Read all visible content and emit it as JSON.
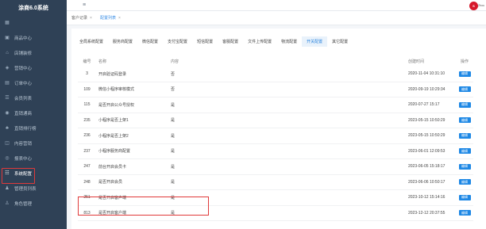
{
  "app": {
    "title": "涂商6.0系统",
    "user_avatar_text": "S",
    "user_name": "Zhou"
  },
  "sidebar": {
    "items": [
      {
        "label": "",
        "icon": "grid-icon"
      },
      {
        "label": "商品中心",
        "icon": "box-icon"
      },
      {
        "label": "店铺装修",
        "icon": "store-icon"
      },
      {
        "label": "营销中心",
        "icon": "promo-icon"
      },
      {
        "label": "订单中心",
        "icon": "order-icon"
      },
      {
        "label": "会员列表",
        "icon": "member-icon"
      },
      {
        "label": "直销通商",
        "icon": "channel-icon"
      },
      {
        "label": "直销排行榜",
        "icon": "ranking-icon"
      },
      {
        "label": "内容营销",
        "icon": "content-icon"
      },
      {
        "label": "报表中心",
        "icon": "report-icon"
      },
      {
        "label": "系统配置",
        "icon": "settings-icon",
        "active": true
      },
      {
        "label": "管理员列表",
        "icon": "admin-icon"
      },
      {
        "label": "角色管理",
        "icon": "role-icon"
      }
    ]
  },
  "page_tabs": [
    {
      "label": "客户记录",
      "active": false
    },
    {
      "label": "配置列表",
      "active": true
    }
  ],
  "sub_tabs": [
    {
      "label": "全局系统配置",
      "active": false
    },
    {
      "label": "服务商配置",
      "active": false
    },
    {
      "label": "微信配置",
      "active": false
    },
    {
      "label": "支付宝配置",
      "active": false
    },
    {
      "label": "短信配置",
      "active": false
    },
    {
      "label": "客服配置",
      "active": false
    },
    {
      "label": "文件上传配置",
      "active": false
    },
    {
      "label": "物流配置",
      "active": false
    },
    {
      "label": "开关配置",
      "active": true
    },
    {
      "label": "其它配置",
      "active": false
    }
  ],
  "table": {
    "headers": {
      "id": "编号",
      "name": "名称",
      "value": "内容",
      "time": "创建时间",
      "op": "操作"
    },
    "edit_label": "编辑",
    "rows": [
      {
        "id": "3",
        "name": "开启验证码登录",
        "value": "否",
        "time": "2020-11-04 10:31:10"
      },
      {
        "id": "109",
        "name": "微信小程序审核模式",
        "value": "否",
        "time": "2020-09-19 10:29:34"
      },
      {
        "id": "115",
        "name": "是否开启公众号授权",
        "value": "是",
        "time": "2020-07-27 15:17"
      },
      {
        "id": "235",
        "name": "小程序是否上架1",
        "value": "是",
        "time": "2023-05-15 10:50:29"
      },
      {
        "id": "236",
        "name": "小程序是否上架2",
        "value": "是",
        "time": "2023-05-15 10:50:29"
      },
      {
        "id": "237",
        "name": "小程序服务商配置",
        "value": "是",
        "time": "2023-06-01 12:09:53"
      },
      {
        "id": "247",
        "name": "前台开启会员卡",
        "value": "是",
        "time": "2023-06-05 15:18:17"
      },
      {
        "id": "248",
        "name": "是否开启会员",
        "value": "是",
        "time": "2023-06-06 10:50:17"
      },
      {
        "id": "251",
        "name": "是否开启客户端",
        "value": "是",
        "time": "2023-10-12 15:14:16"
      },
      {
        "id": "813",
        "name": "是否开启客户端",
        "value": "是",
        "time": "2023-12-12 20:37:55"
      }
    ]
  },
  "colors": {
    "sidebar_bg": "#2f4156",
    "accent": "#1e88e5",
    "highlight": "#e03a3a"
  }
}
